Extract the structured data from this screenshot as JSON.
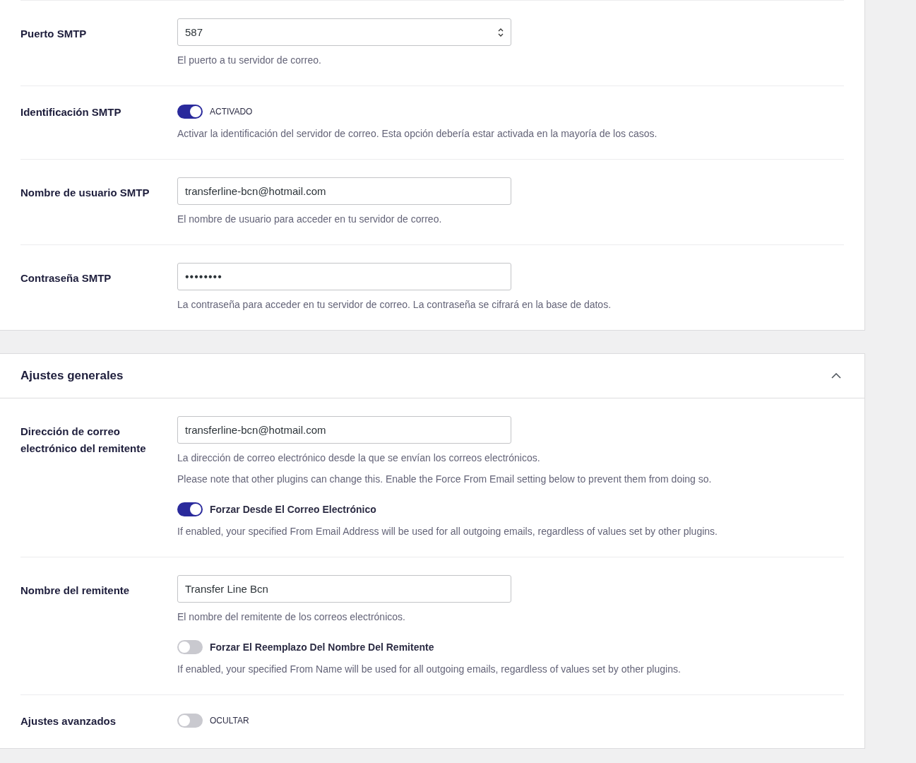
{
  "sections": [
    {
      "rows": [
        {
          "label": "Puerto SMTP",
          "control": {
            "kind": "number",
            "value": "587"
          },
          "help": [
            "El puerto a tu servidor de correo."
          ]
        },
        {
          "label": "Identificación SMTP",
          "control": {
            "kind": "toggle",
            "on": true,
            "label": "ACTIVADO"
          },
          "help": [
            "Activar la identificación del servidor de correo. Esta opción debería estar activada en la mayoría de los casos."
          ]
        },
        {
          "label": "Nombre de usuario SMTP",
          "control": {
            "kind": "text",
            "value": "transferline-bcn@hotmail.com"
          },
          "help": [
            "El nombre de usuario para acceder en tu servidor de correo."
          ]
        },
        {
          "label": "Contraseña SMTP",
          "control": {
            "kind": "password",
            "value": "••••••••"
          },
          "help": [
            "La contraseña para acceder en tu servidor de correo. La contraseña se cifrará en la base de datos."
          ]
        }
      ]
    },
    {
      "header": {
        "title": "Ajustes generales",
        "expanded": true
      },
      "rows": [
        {
          "label": "Dirección de correo electrónico del remitente",
          "control": {
            "kind": "text",
            "value": "transferline-bcn@hotmail.com"
          },
          "help": [
            "La dirección de correo electrónico desde la que se envían los correos electrónicos.",
            "Please note that other plugins can change this. Enable the Force From Email setting below to prevent them from doing so."
          ],
          "option": {
            "on": true,
            "label": "Forzar Desde El Correo Electrónico",
            "help": "If enabled, your specified From Email Address will be used for all outgoing emails, regardless of values set by other plugins."
          }
        },
        {
          "label": "Nombre del remitente",
          "control": {
            "kind": "text",
            "value": "Transfer Line Bcn"
          },
          "help": [
            "El nombre del remitente de los correos electrónicos."
          ],
          "option": {
            "on": false,
            "label": "Forzar El Reemplazo Del Nombre Del Remitente",
            "help": "If enabled, your specified From Name will be used for all outgoing emails, regardless of values set by other plugins."
          }
        },
        {
          "label": "Ajustes avanzados",
          "control": {
            "kind": "toggle",
            "on": false,
            "label": "OCULTAR"
          }
        }
      ]
    }
  ]
}
